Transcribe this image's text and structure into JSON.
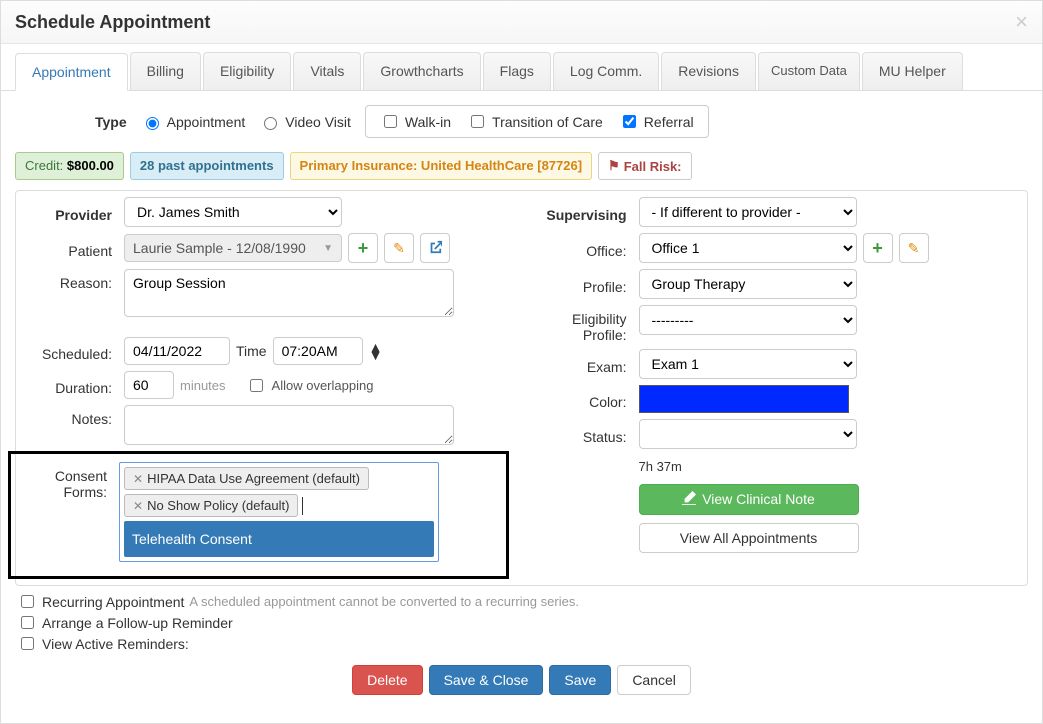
{
  "header": {
    "title": "Schedule Appointment"
  },
  "tabs": [
    "Appointment",
    "Billing",
    "Eligibility",
    "Vitals",
    "Growthcharts",
    "Flags",
    "Log Comm.",
    "Revisions",
    "Custom Data",
    "MU Helper"
  ],
  "type": {
    "label": "Type",
    "appointment": "Appointment",
    "video": "Video Visit",
    "walkin": "Walk-in",
    "transition": "Transition of Care",
    "referral": "Referral"
  },
  "badges": {
    "credit_label": "Credit: ",
    "credit_value": "$800.00",
    "past": "28 past appointments",
    "insurance": "Primary Insurance: United HealthCare [87726]",
    "fall_risk": "Fall Risk:"
  },
  "left": {
    "provider_label": "Provider",
    "provider_value": "Dr. James Smith",
    "patient_label": "Patient",
    "patient_value": "Laurie Sample - 12/08/1990",
    "reason_label": "Reason:",
    "reason_value": "Group Session",
    "scheduled_label": "Scheduled:",
    "date_value": "04/11/2022",
    "time_label": "Time",
    "time_value": "07:20AM",
    "duration_label": "Duration:",
    "duration_value": "60",
    "minutes": "minutes",
    "overlap": "Allow overlapping",
    "notes_label": "Notes:",
    "consent_label_1": "Consent",
    "consent_label_2": "Forms:",
    "consent_tag_1": "HIPAA Data Use Agreement (default)",
    "consent_tag_2": "No Show Policy (default)",
    "consent_option": "Telehealth Consent"
  },
  "right": {
    "supervising_label": "Supervising",
    "supervising_value": "- If different to provider -",
    "office_label": "Office:",
    "office_value": "Office 1",
    "profile_label": "Profile:",
    "profile_value": "Group Therapy",
    "elig_label_1": "Eligibility",
    "elig_label_2": "Profile:",
    "elig_value": "---------",
    "exam_label": "Exam:",
    "exam_value": "Exam 1",
    "color_label": "Color:",
    "status_label": "Status:",
    "status_value": "",
    "time_under": "7h 37m",
    "view_clinical": "View Clinical Note",
    "view_all": "View All Appointments"
  },
  "below": {
    "recurring": "Recurring Appointment",
    "recurring_note": "A scheduled appointment cannot be converted to a recurring series.",
    "followup": "Arrange a Follow-up Reminder",
    "active": "View Active Reminders:"
  },
  "footer": {
    "delete": "Delete",
    "save_close": "Save & Close",
    "save": "Save",
    "cancel": "Cancel"
  }
}
